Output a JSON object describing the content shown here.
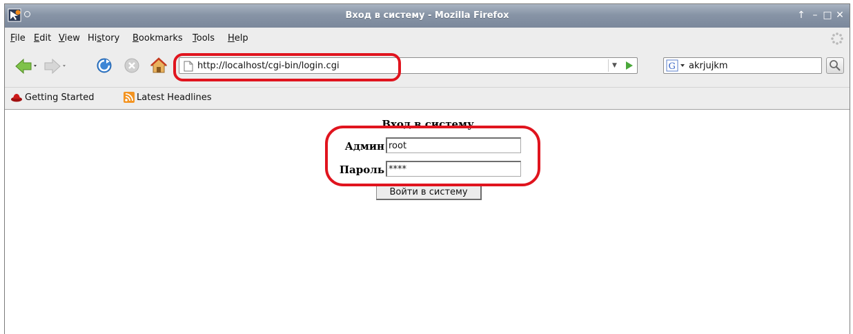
{
  "window": {
    "title": "Вход в систему - Mozilla Firefox"
  },
  "menu": [
    "File",
    "Edit",
    "View",
    "History",
    "Bookmarks",
    "Tools",
    "Help"
  ],
  "menu_access_keys": [
    "F",
    "E",
    "V",
    "s",
    "B",
    "T",
    "H"
  ],
  "navigation": {
    "url": "http://localhost/cgi-bin/login.cgi",
    "search_value": "akrjujkm"
  },
  "bookmarks": [
    "Getting Started",
    "Latest Headlines"
  ],
  "form": {
    "heading": "Вход в систему",
    "admin_label": "Админ",
    "admin_value": "root",
    "password_label": "Пароль",
    "password_value": "****",
    "submit_label": "Войти в систему"
  },
  "colors": {
    "annotation": "#e0141e",
    "titlebar": "#8794a6"
  },
  "icons": [
    "app-icon",
    "pin-icon",
    "back-icon",
    "forward-icon",
    "reload-icon",
    "stop-icon",
    "home-icon",
    "page-icon",
    "go-icon",
    "google-icon",
    "search-icon",
    "throbber-icon",
    "redhat-icon",
    "rss-icon"
  ]
}
